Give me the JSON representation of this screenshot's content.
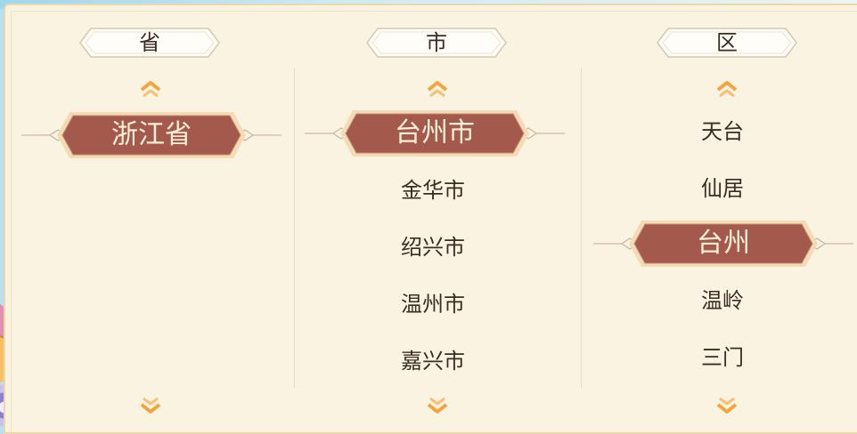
{
  "columns": [
    {
      "key": "province",
      "header": "省",
      "selected": "浙江省",
      "items_above": [],
      "items_below": []
    },
    {
      "key": "city",
      "header": "市",
      "selected": "台州市",
      "items_above": [],
      "items_below": [
        "金华市",
        "绍兴市",
        "温州市",
        "嘉兴市"
      ]
    },
    {
      "key": "district",
      "header": "区",
      "selected": "台州",
      "items_above": [
        "天台",
        "仙居"
      ],
      "items_below": [
        "温岭",
        "三门"
      ]
    }
  ],
  "icons": {
    "scroll_up": "chevron-up-icon",
    "scroll_down": "chevron-down-icon"
  },
  "colors": {
    "panel_bg": "#faf3e2",
    "selected_bg": "#a35a4c",
    "selected_text": "#fff0d8",
    "chevron": "#f4a43a",
    "header_border": "#d9c7ae"
  }
}
